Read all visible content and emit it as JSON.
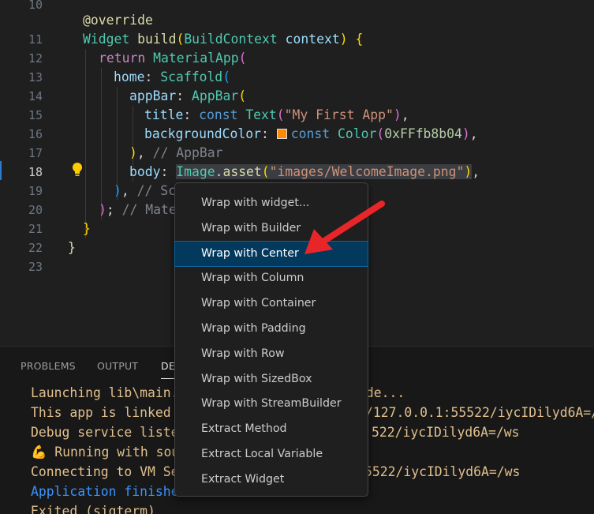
{
  "editor": {
    "line_numbers": [
      "10",
      "11",
      "12",
      "13",
      "14",
      "15",
      "16",
      "17",
      "18",
      "19",
      "20",
      "21",
      "22",
      "23"
    ],
    "active_line": "18",
    "code": {
      "l10": {
        "annotation": "@override"
      },
      "l11": {
        "type": "Widget",
        "fn": "build",
        "open": "(",
        "param_type": "BuildContext",
        "param": "context",
        "close": ")",
        "brace": "{"
      },
      "l12": {
        "kw": "return",
        "cls": "MaterialApp",
        "open": "("
      },
      "l13": {
        "prop": "home",
        "colon": ":",
        "cls": "Scaffold",
        "open": "("
      },
      "l14": {
        "prop": "appBar",
        "colon": ":",
        "cls": "AppBar",
        "open": "("
      },
      "l15": {
        "prop": "title",
        "colon": ":",
        "kw": "const",
        "cls": "Text",
        "open": "(",
        "str": "\"My First App\"",
        "close": ")",
        "comma": ","
      },
      "l16": {
        "prop": "backgroundColor",
        "colon": ":",
        "kw": "const",
        "cls": "Color",
        "open": "(",
        "num": "0xFFfb8b04",
        "close": ")",
        "comma": ","
      },
      "l17": {
        "close": ")",
        "comma": ",",
        "comment": "// AppBar"
      },
      "l18": {
        "prop": "body",
        "colon": ":",
        "cls": "Image",
        "dot": ".",
        "fn": "asset",
        "open": "(",
        "str": "\"images/WelcomeImage.png\"",
        "close": ")",
        "comma": ","
      },
      "l19": {
        "close": ")",
        "comma": ",",
        "comment": "// Sc"
      },
      "l20": {
        "close": ")",
        "semi": ";",
        "comment": "// Mate"
      },
      "l21": {
        "brace": "}"
      },
      "l22": {
        "brace": "}"
      }
    },
    "swatch_color": "#fb8b04",
    "lightbulb_icon": "lightbulb-icon"
  },
  "panel": {
    "tabs": [
      {
        "label": "PROBLEMS"
      },
      {
        "label": "OUTPUT"
      },
      {
        "label": "DE"
      }
    ],
    "output_lines": [
      {
        "left": "Launching lib\\main.",
        "right": "ode..."
      },
      {
        "left": "This app is linked",
        "right": "/127.0.0.1:55522/iycIDilyd6A=/"
      },
      {
        "left": "Debug service liste",
        "right": "522/iycIDilyd6A=/ws"
      },
      {
        "emoji": "💪",
        "left": " Running with sou",
        "right": ""
      },
      {
        "left": "Connecting to VM Se",
        "right": "5522/iycIDilyd6A=/ws"
      },
      {
        "left": "Application finishe",
        "right": ""
      },
      {
        "left": "Exited (sigterm)",
        "right": ""
      }
    ]
  },
  "context_menu": {
    "items": [
      {
        "label": "Wrap with widget..."
      },
      {
        "label": "Wrap with Builder"
      },
      {
        "label": "Wrap with Center"
      },
      {
        "label": "Wrap with Column"
      },
      {
        "label": "Wrap with Container"
      },
      {
        "label": "Wrap with Padding"
      },
      {
        "label": "Wrap with Row"
      },
      {
        "label": "Wrap with SizedBox"
      },
      {
        "label": "Wrap with StreamBuilder"
      },
      {
        "label": "Extract Method"
      },
      {
        "label": "Extract Local Variable"
      },
      {
        "label": "Extract Widget"
      }
    ],
    "selected_index": 2
  },
  "annotation": {
    "arrow_color": "#e8262a"
  }
}
